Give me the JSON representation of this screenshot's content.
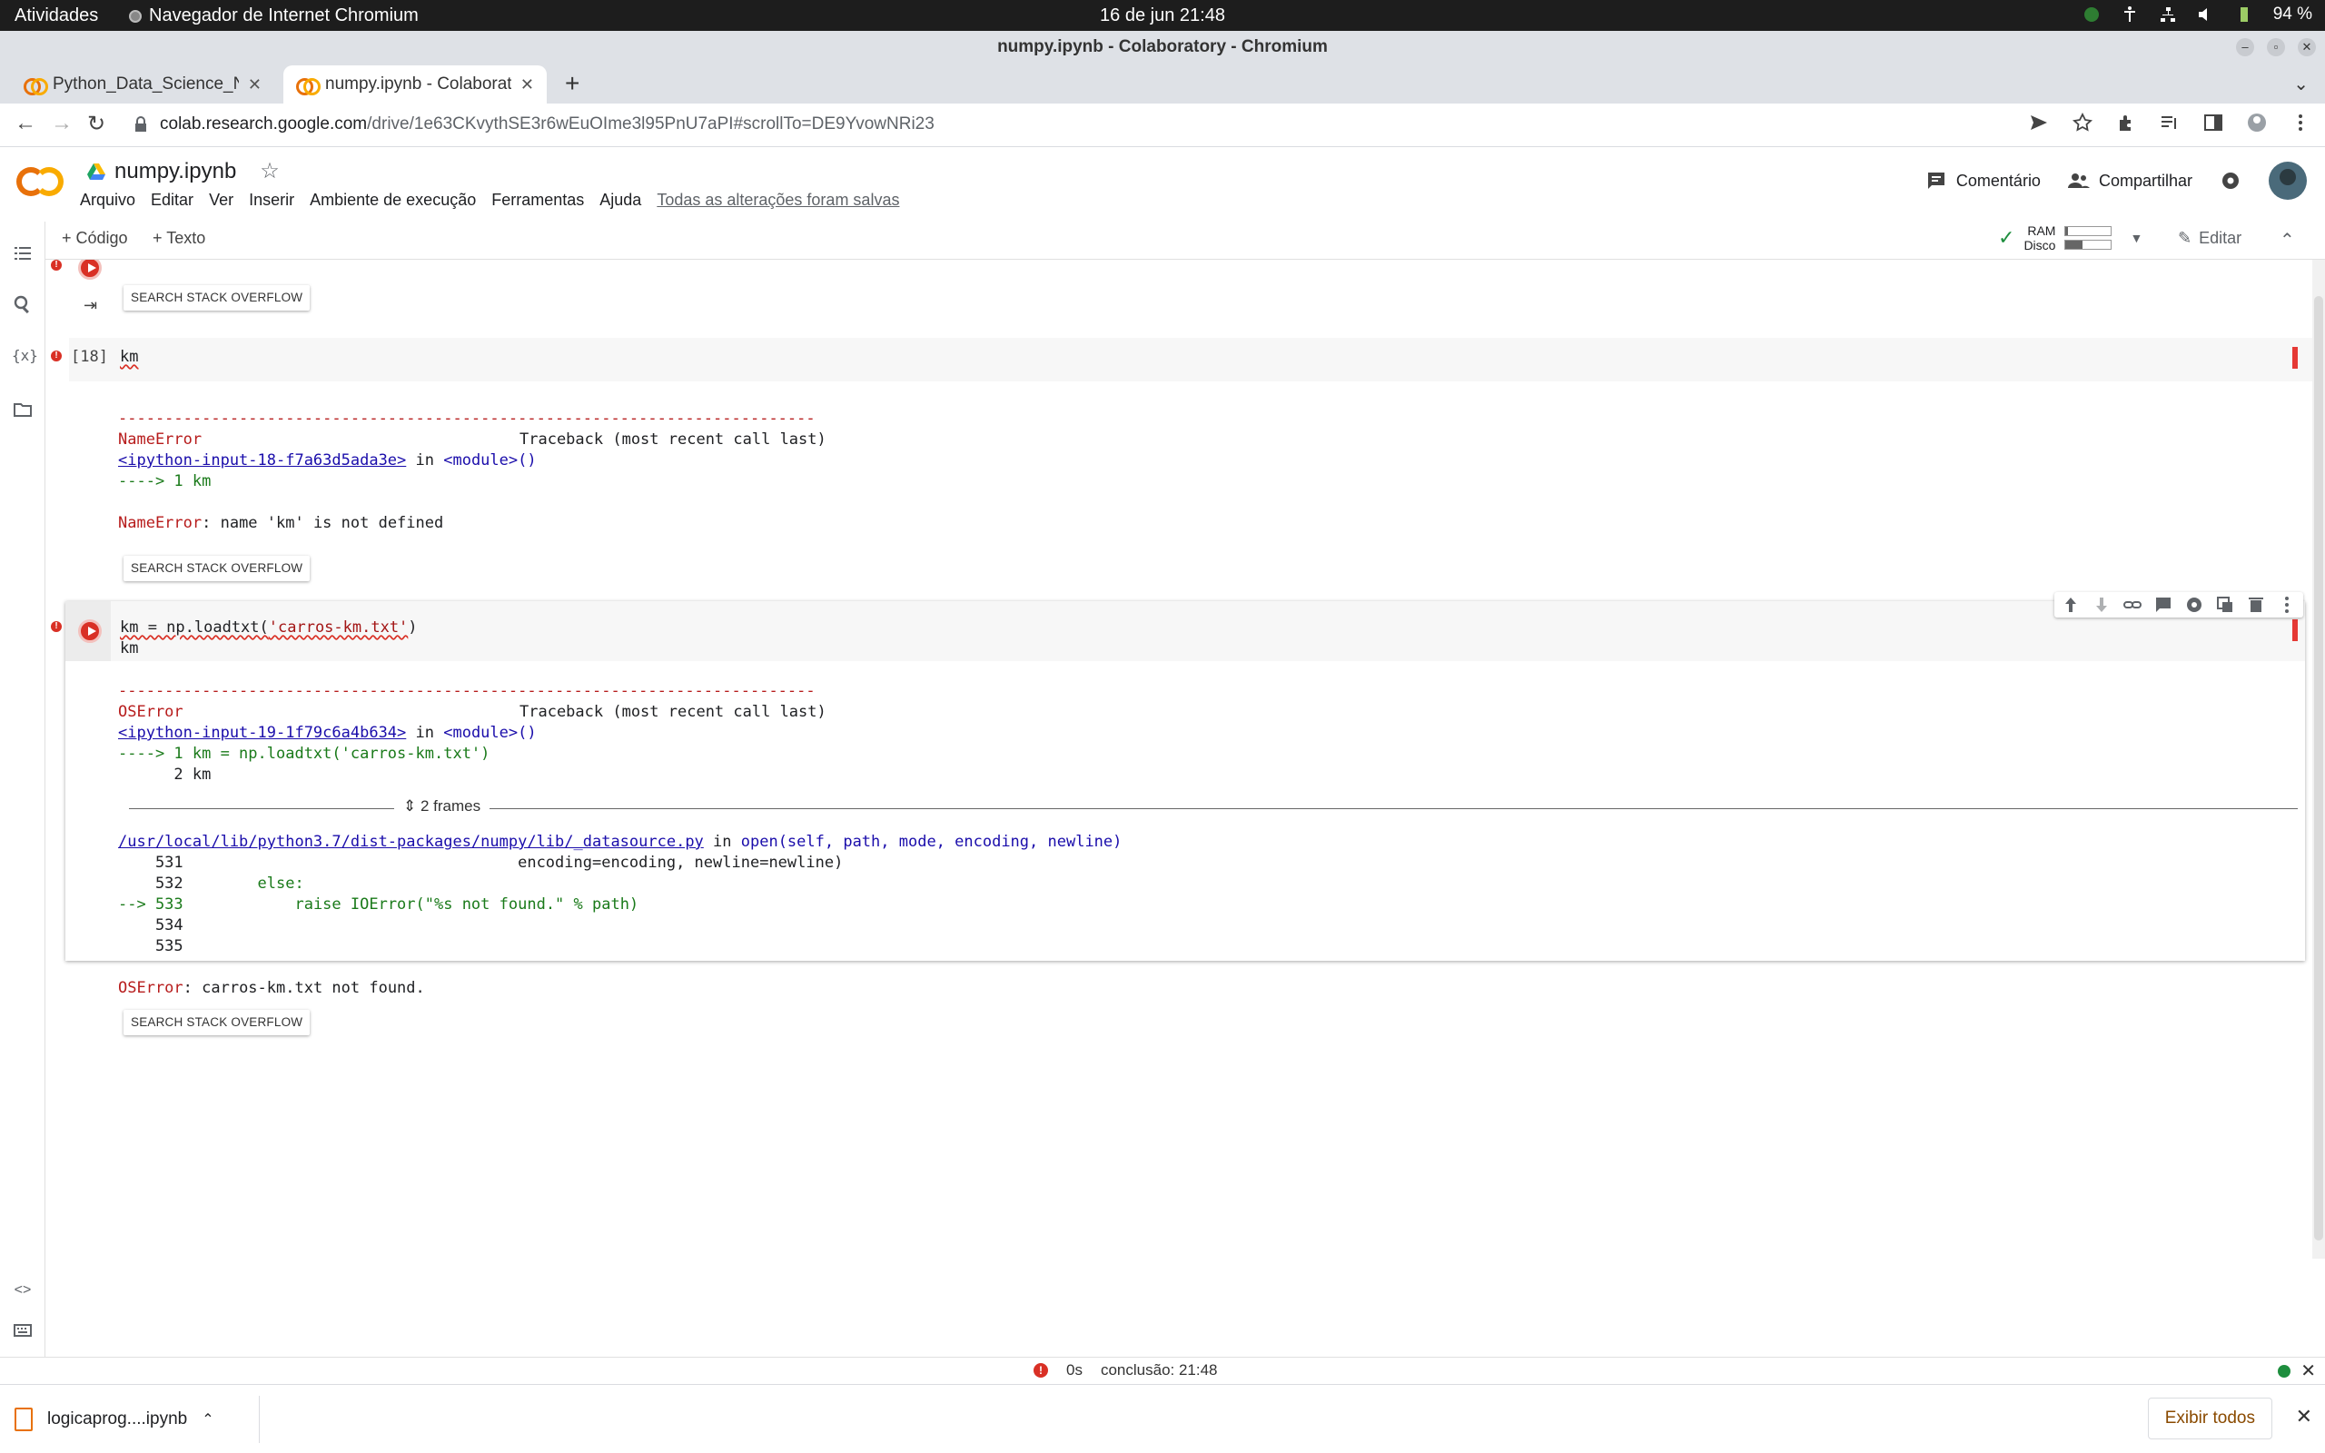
{
  "system": {
    "activities": "Atividades",
    "app_name": "Navegador de Internet Chromium",
    "clock": "16 de jun  21:48",
    "battery": "94 %"
  },
  "window": {
    "title": "numpy.ipynb - Colaboratory - Chromium"
  },
  "tabs": [
    {
      "label": "Python_Data_Science_Nu",
      "active": false
    },
    {
      "label": "numpy.ipynb - Colaborato",
      "active": true
    }
  ],
  "address": {
    "host": "colab.research.google.com",
    "path": "/drive/1e63CKvythSE3r6wEuOIme3l95PnU7aPI#scrollTo=DE9YvowNRi23"
  },
  "colab": {
    "notebook_name": "numpy.ipynb",
    "menu": [
      "Arquivo",
      "Editar",
      "Ver",
      "Inserir",
      "Ambiente de execução",
      "Ferramentas",
      "Ajuda"
    ],
    "saved_status": "Todas as alterações foram salvas",
    "comment_label": "Comentário",
    "share_label": "Compartilhar"
  },
  "toolbar": {
    "add_code": "Código",
    "add_text": "Texto",
    "ram_label": "RAM",
    "disk_label": "Disco",
    "ram_level": 0.05,
    "disk_level": 0.38,
    "edit_label": "Editar"
  },
  "cells": {
    "so_button": "SEARCH STACK OVERFLOW",
    "c18": {
      "prompt": "[18]",
      "code": "km",
      "dashes": "---------------------------------------------------------------------------",
      "err_name": "NameError",
      "traceback_head": "Traceback (most recent call last)",
      "input_link": "<ipython-input-18-f7a63d5ada3e>",
      "in_word": " in ",
      "module": "<module>()",
      "arrow_line": "----> 1 km",
      "err_msg_name": "NameError",
      "err_msg": ": name 'km' is not defined"
    },
    "c19": {
      "code_line1_a": "km = np.loadtxt(",
      "code_line1_str": "'carros-km.txt'",
      "code_line1_b": ")",
      "code_line2": "km",
      "dashes": "---------------------------------------------------------------------------",
      "err_name": "OSError",
      "traceback_head": "Traceback (most recent call last)",
      "input_link": "<ipython-input-19-1f79c6a4b634>",
      "in_word": " in ",
      "module": "<module>()",
      "arrow_line1": "----> 1 km = np.loadtxt('carros-km.txt')",
      "line2": "      2 km",
      "frames_label": "2 frames",
      "lib_link": "/usr/local/lib/python3.7/dist-packages/numpy/lib/_datasource.py",
      "lib_in": " in ",
      "lib_func": "open(self, path, mode, encoding, newline)",
      "l531": "    531                                    encoding=encoding, newline=newline)",
      "l532_num": "    532",
      "l532_code": "        else:",
      "l533_arrow": "--> 533",
      "l533_code": "            raise IOError(\"%s not found.\" % path)",
      "l534": "    534",
      "l535": "    535",
      "final_name": "OSError",
      "final_msg": ": carros-km.txt not found."
    }
  },
  "status": {
    "time": "0s",
    "completion": "conclusão: 21:48"
  },
  "downloads": {
    "file": "logicaprog....ipynb",
    "show_all": "Exibir todos"
  }
}
